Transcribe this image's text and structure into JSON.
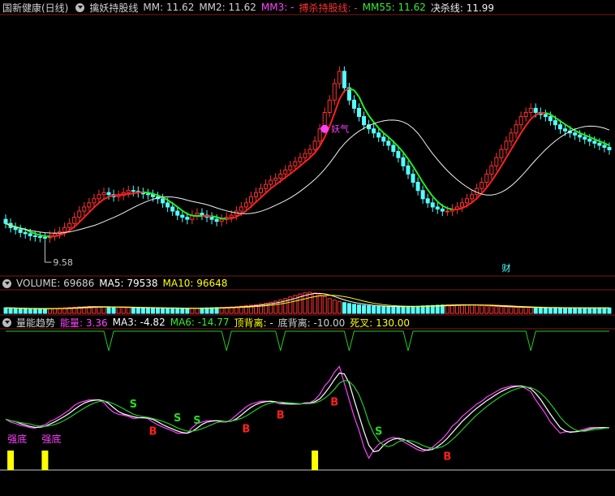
{
  "header_main": {
    "stock": "国新健康(日线)",
    "indicator": "擒妖持股线",
    "mm": {
      "label": "MM: ",
      "value": "11.62"
    },
    "mm2": {
      "label": "MM2: ",
      "value": "11.62"
    },
    "mm3": {
      "label": "MM3: ",
      "value": "-"
    },
    "bosha": {
      "label": "搏杀持股线: ",
      "value": "-"
    },
    "mm55": {
      "label": "MM55: ",
      "value": "11.62"
    },
    "jueshao": {
      "label": "决杀线: ",
      "value": "11.99"
    }
  },
  "header_volume": {
    "volume": {
      "label": "VOLUME: ",
      "value": "69686"
    },
    "ma5": {
      "label": "MA5: ",
      "value": "79538"
    },
    "ma10": {
      "label": "MA10: ",
      "value": "96648"
    }
  },
  "header_energy": {
    "name": "量能趋势",
    "nengliang": {
      "label": "能量: ",
      "value": "3.36"
    },
    "ma3": {
      "label": "MA3: ",
      "value": "-4.82"
    },
    "ma6": {
      "label": "MA6: ",
      "value": "-14.77"
    },
    "dingbeili": {
      "label": "顶背离: ",
      "value": "-"
    },
    "dibeili": {
      "label": "底背离: ",
      "value": "-10.00"
    },
    "sicha": {
      "label": "死叉: ",
      "value": "130.00"
    }
  },
  "colors": {
    "up": "#ff3232",
    "down": "#54ffff",
    "mm_line": "#ff2020",
    "mm55_line": "#22ee22",
    "jueshao_line": "#f0f0f0",
    "ma5_vol": "#ffffff",
    "ma10_vol": "#ffff00",
    "energy": "#ff40ff",
    "ma3": "#ffffff",
    "ma6": "#22cc22",
    "signal_s": "#22dd22",
    "signal_b": "#ff2020",
    "strong_bottom": "#ffff00",
    "header_magenta": "#ff44ff",
    "header_red": "#ff3030",
    "header_green": "#33ee33",
    "header_yellow": "#ffff00",
    "header_cyan": "#54ffff"
  },
  "chart_data": [
    {
      "type": "candlestick",
      "panel": "main",
      "x": [
        0,
        1,
        2,
        3,
        4,
        5,
        6,
        7,
        8,
        9,
        10,
        11,
        12,
        13,
        14,
        15,
        16,
        17,
        18,
        19,
        20,
        21,
        22,
        23,
        24,
        25,
        26,
        27,
        28,
        29,
        30,
        31,
        32,
        33,
        34,
        35,
        36,
        37,
        38,
        39,
        40,
        41,
        42,
        43,
        44,
        45,
        46,
        47,
        48,
        49,
        50,
        51,
        52,
        53,
        54,
        55,
        56,
        57,
        58,
        59,
        60,
        61,
        62,
        63,
        64,
        65,
        66,
        67,
        68,
        69,
        70,
        71,
        72,
        73,
        74,
        75,
        76,
        77,
        78,
        79,
        80,
        81,
        82,
        83,
        84,
        85,
        86,
        87,
        88,
        89,
        90,
        91,
        92,
        93,
        94,
        95,
        96,
        97,
        98,
        99,
        100,
        101,
        102,
        103,
        104,
        105,
        106,
        107,
        108,
        109,
        110,
        111,
        112,
        113,
        114,
        115,
        116,
        117,
        118,
        119,
        120,
        121,
        122,
        123
      ],
      "open": [
        10.3,
        10.2,
        10.1,
        10.05,
        9.98,
        9.95,
        9.9,
        9.88,
        9.86,
        9.85,
        9.9,
        9.95,
        10.0,
        10.1,
        10.2,
        10.35,
        10.5,
        10.6,
        10.7,
        10.8,
        10.9,
        10.95,
        10.9,
        10.85,
        10.88,
        10.95,
        11.0,
        10.98,
        10.95,
        10.92,
        10.9,
        10.85,
        10.8,
        10.7,
        10.6,
        10.5,
        10.4,
        10.35,
        10.3,
        10.4,
        10.45,
        10.4,
        10.35,
        10.3,
        10.25,
        10.3,
        10.35,
        10.4,
        10.5,
        10.6,
        10.7,
        10.85,
        10.95,
        11.05,
        11.15,
        11.25,
        11.3,
        11.4,
        11.5,
        11.6,
        11.7,
        11.8,
        11.9,
        12.0,
        12.2,
        12.5,
        12.9,
        13.2,
        13.6,
        13.9,
        13.5,
        13.2,
        13.0,
        12.8,
        12.6,
        12.5,
        12.4,
        12.3,
        12.2,
        12.1,
        11.95,
        11.8,
        11.6,
        11.4,
        11.2,
        11.0,
        10.8,
        10.7,
        10.6,
        10.55,
        10.5,
        10.5,
        10.55,
        10.6,
        10.7,
        10.8,
        10.9,
        11.05,
        11.2,
        11.4,
        11.6,
        11.8,
        12.0,
        12.2,
        12.4,
        12.6,
        12.8,
        12.9,
        13.0,
        12.9,
        12.85,
        12.8,
        12.7,
        12.6,
        12.5,
        12.45,
        12.4,
        12.35,
        12.3,
        12.25,
        12.2,
        12.15,
        12.1,
        12.05
      ],
      "close": [
        10.2,
        10.1,
        10.05,
        9.98,
        9.95,
        9.9,
        9.88,
        9.86,
        9.85,
        9.9,
        9.95,
        10.0,
        10.1,
        10.2,
        10.35,
        10.5,
        10.6,
        10.7,
        10.8,
        10.9,
        10.95,
        10.9,
        10.85,
        10.88,
        10.95,
        11.0,
        10.98,
        10.95,
        10.92,
        10.9,
        10.85,
        10.8,
        10.7,
        10.6,
        10.5,
        10.4,
        10.35,
        10.3,
        10.4,
        10.45,
        10.4,
        10.35,
        10.3,
        10.25,
        10.3,
        10.35,
        10.4,
        10.5,
        10.6,
        10.7,
        10.85,
        10.95,
        11.05,
        11.15,
        11.25,
        11.3,
        11.4,
        11.5,
        11.6,
        11.7,
        11.8,
        11.9,
        12.0,
        12.2,
        12.5,
        12.9,
        13.2,
        13.6,
        13.9,
        13.5,
        13.2,
        13.0,
        12.8,
        12.6,
        12.5,
        12.4,
        12.3,
        12.2,
        12.1,
        11.95,
        11.8,
        11.6,
        11.4,
        11.2,
        11.0,
        10.8,
        10.7,
        10.6,
        10.55,
        10.5,
        10.5,
        10.55,
        10.6,
        10.7,
        10.8,
        10.9,
        11.05,
        11.2,
        11.4,
        11.6,
        11.8,
        12.0,
        12.2,
        12.4,
        12.6,
        12.8,
        12.9,
        13.0,
        12.9,
        12.85,
        12.8,
        12.7,
        12.6,
        12.5,
        12.45,
        12.4,
        12.35,
        12.3,
        12.25,
        12.2,
        12.15,
        12.1,
        12.05,
        11.99
      ],
      "ylim": [
        9.0,
        15.2
      ],
      "annotations": [
        "9.58",
        "妖气",
        "财"
      ]
    },
    {
      "type": "bar",
      "panel": "volume",
      "series": [
        {
          "name": "VOLUME",
          "values": [
            72000,
            68000,
            65000,
            62000,
            60000,
            58000,
            57000,
            56000,
            58000,
            61000,
            64000,
            67000,
            70000,
            74000,
            78000,
            82000,
            85000,
            88000,
            86000,
            84000,
            82000,
            80000,
            78000,
            76000,
            75000,
            74000,
            73000,
            72000,
            71000,
            70000,
            69000,
            68000,
            67000,
            66000,
            65000,
            64000,
            63000,
            62000,
            64000,
            66000,
            68000,
            70000,
            72000,
            74000,
            76000,
            78000,
            82000,
            86000,
            92000,
            98000,
            104000,
            112000,
            120000,
            130000,
            142000,
            156000,
            172000,
            190000,
            210000,
            230000,
            248000,
            262000,
            270000,
            260000,
            240000,
            215000,
            190000,
            170000,
            152000,
            138000,
            126000,
            116000,
            108000,
            102000,
            97000,
            93000,
            90000,
            88000,
            87000,
            86000,
            86000,
            87000,
            88000,
            90000,
            92000,
            95000,
            98000,
            101000,
            104000,
            106000,
            108000,
            109000,
            110000,
            110000,
            109000,
            107000,
            104000,
            100000,
            96000,
            92000,
            88000,
            85000,
            82000,
            80000,
            78000,
            77000,
            76000,
            75000,
            74000,
            73000,
            72000,
            71000,
            70500,
            70000,
            70000,
            69900,
            69800,
            69750,
            69720,
            69700,
            69690,
            69688,
            69687,
            69686
          ]
        },
        {
          "name": "MA5"
        },
        {
          "name": "MA10"
        }
      ]
    },
    {
      "type": "line",
      "panel": "energy",
      "series": [
        {
          "name": "能量"
        },
        {
          "name": "MA3"
        },
        {
          "name": "MA6"
        }
      ],
      "signals": {
        "S": [
          26,
          35,
          39,
          76
        ],
        "B": [
          30,
          49,
          56,
          67,
          90
        ]
      },
      "strong_bottom_label": "强底"
    }
  ]
}
